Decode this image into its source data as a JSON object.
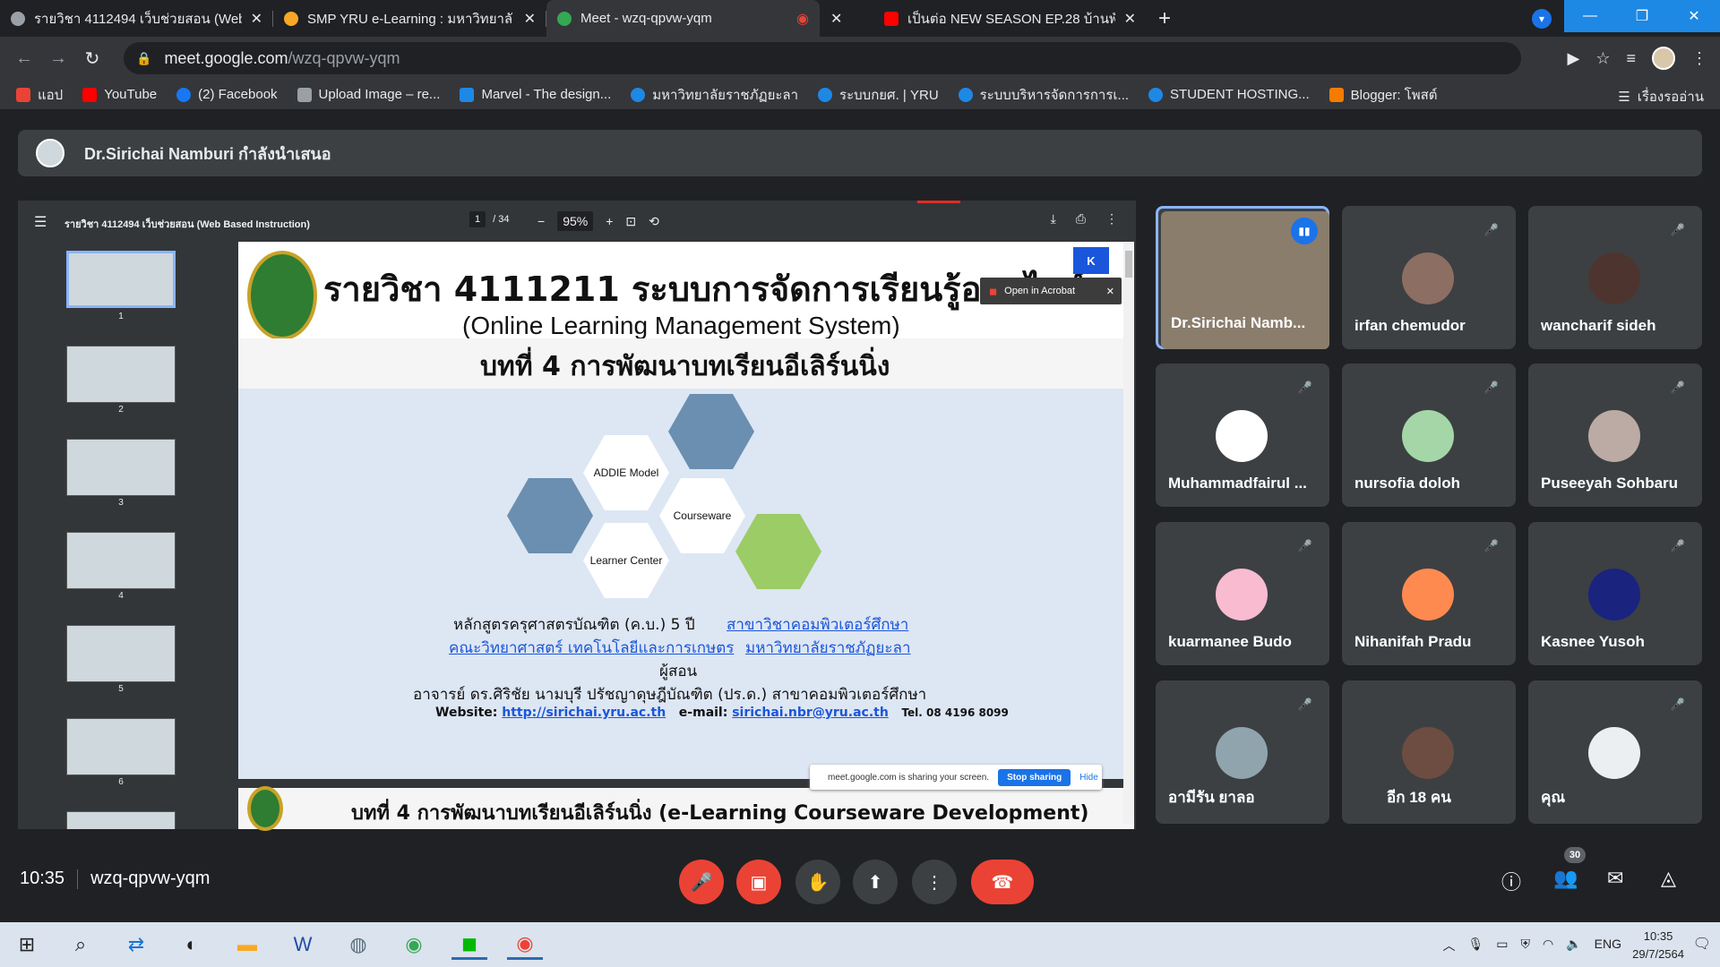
{
  "browser": {
    "tabs": [
      {
        "title": "รายวิชา 4112494 เว็บช่วยสอน (Web",
        "color": "#9aa0a6"
      },
      {
        "title": "SMP YRU e-Learning : มหาวิทยาลั",
        "color": "#f9a825"
      },
      {
        "title": "Meet - wzq-qpvw-yqm",
        "color": "#34a853"
      },
      {
        "title": "",
        "color": "#ea4335"
      },
      {
        "title": "เป็นต่อ NEW SEASON EP.28 บ้านพั",
        "color": "#ff0000"
      }
    ],
    "new_tab_label": "+",
    "url_host": "meet.google.com",
    "url_path": "/wzq-qpvw-yqm",
    "bookmarks": [
      {
        "label": "แอป",
        "color": "#ea4335"
      },
      {
        "label": "YouTube",
        "color": "#ff0000"
      },
      {
        "label": "(2) Facebook",
        "color": "#1877f2"
      },
      {
        "label": "Upload Image – re...",
        "color": "#9aa0a6"
      },
      {
        "label": "Marvel - The design...",
        "color": "#1e88e5"
      },
      {
        "label": "มหาวิทยาลัยราชภัฏยะลา",
        "color": "#1e88e5"
      },
      {
        "label": "ระบบกยศ. | YRU",
        "color": "#1e88e5"
      },
      {
        "label": "ระบบบริหารจัดการการเ...",
        "color": "#1e88e5"
      },
      {
        "label": "STUDENT HOSTING...",
        "color": "#1e88e5"
      },
      {
        "label": "Blogger: โพสต์",
        "color": "#f57c00"
      }
    ],
    "reading_list": "เรื่องรออ่าน"
  },
  "meet": {
    "presenter_banner": "Dr.Sirichai Namburi กำลังนำเสนอ",
    "viewer": {
      "doc_title": "รายวิชา 4112494 เว็บช่วยสอน (Web Based Instruction)",
      "page_current": "1",
      "page_total": "/ 34",
      "zoom": "95%",
      "thumbnail_numbers": [
        "1",
        "2",
        "3",
        "4",
        "5",
        "6"
      ],
      "open_acrobat": "Open in Acrobat",
      "kbadge": "K"
    },
    "slide": {
      "title": "รายวิชา 4111211 ระบบการจัดการเรียนรู้ออนไลน์",
      "subtitle": "(Online Learning Management System)",
      "chapter": "บทที่ 4 การพัฒนาบทเรียนอีเลิร์นนิ่ง",
      "hex_addie": "ADDIE Model",
      "hex_courseware": "Courseware",
      "hex_learner": "Learner Center",
      "program": "หลักสูตรครุศาสตรบัณฑิต (ค.บ.)  5  ปี",
      "program_link": "สาขาวิชาคอมพิวเตอร์ศึกษา",
      "faculty_link": "คณะวิทยาศาสตร์ เทคโนโลยีและการเกษตร",
      "university_link": "มหาวิทยาลัยราชภัฏยะลา",
      "instructor_label": "ผู้สอน",
      "instructor": "อาจารย์ ดร.ศิริชัย นามบุรี    ปรัชญาดุษฎีบัณฑิต (ปร.ด.) สาขาคอมพิวเตอร์ศึกษา",
      "website_label": "Website:",
      "website": "http://sirichai.yru.ac.th",
      "email_label": "e-mail:",
      "email": "sirichai.nbr@yru.ac.th",
      "tel": "Tel. 08 4196 8099",
      "page2_title": "บทที่ 4 การพัฒนาบทเรียนอีเลิร์นนิ่ง (e-Learning Courseware Development)"
    },
    "share_popup": {
      "text": "meet.google.com is sharing your screen.",
      "stop": "Stop sharing",
      "hide": "Hide"
    },
    "participants": [
      {
        "name": "Dr.Sirichai Namb...",
        "muted": false,
        "speaking": true,
        "color": "#8a7d6c"
      },
      {
        "name": "irfan chemudor",
        "muted": true,
        "color": "#8d6e63"
      },
      {
        "name": "wancharif sideh",
        "muted": true,
        "color": "#4e342e"
      },
      {
        "name": "Muhammadfairul ...",
        "muted": true,
        "color": "#ffffff"
      },
      {
        "name": "nursofia doloh",
        "muted": true,
        "color": "#a5d6a7"
      },
      {
        "name": "Puseeyah Sohbaru",
        "muted": true,
        "color": "#bcaaa4"
      },
      {
        "name": "kuarmanee Budo",
        "muted": true,
        "color": "#f8bbd0"
      },
      {
        "name": "Nihanifah Pradu",
        "muted": true,
        "color": "#ff8a50"
      },
      {
        "name": "Kasnee Yusoh",
        "muted": true,
        "color": "#1a237e"
      },
      {
        "name": "อามีรัน ยาลอ",
        "muted": true,
        "color": "#90a4ae"
      },
      {
        "name": "อีก 18 คน",
        "muted": false,
        "color": "#6d4c41"
      },
      {
        "name": "คุณ",
        "muted": true,
        "color": "#eceff1"
      }
    ],
    "bottom": {
      "time": "10:35",
      "meeting_code": "wzq-qpvw-yqm",
      "participant_count": "30"
    }
  },
  "taskbar": {
    "lang": "ENG",
    "time": "10:35",
    "date": "29/7/2564"
  }
}
